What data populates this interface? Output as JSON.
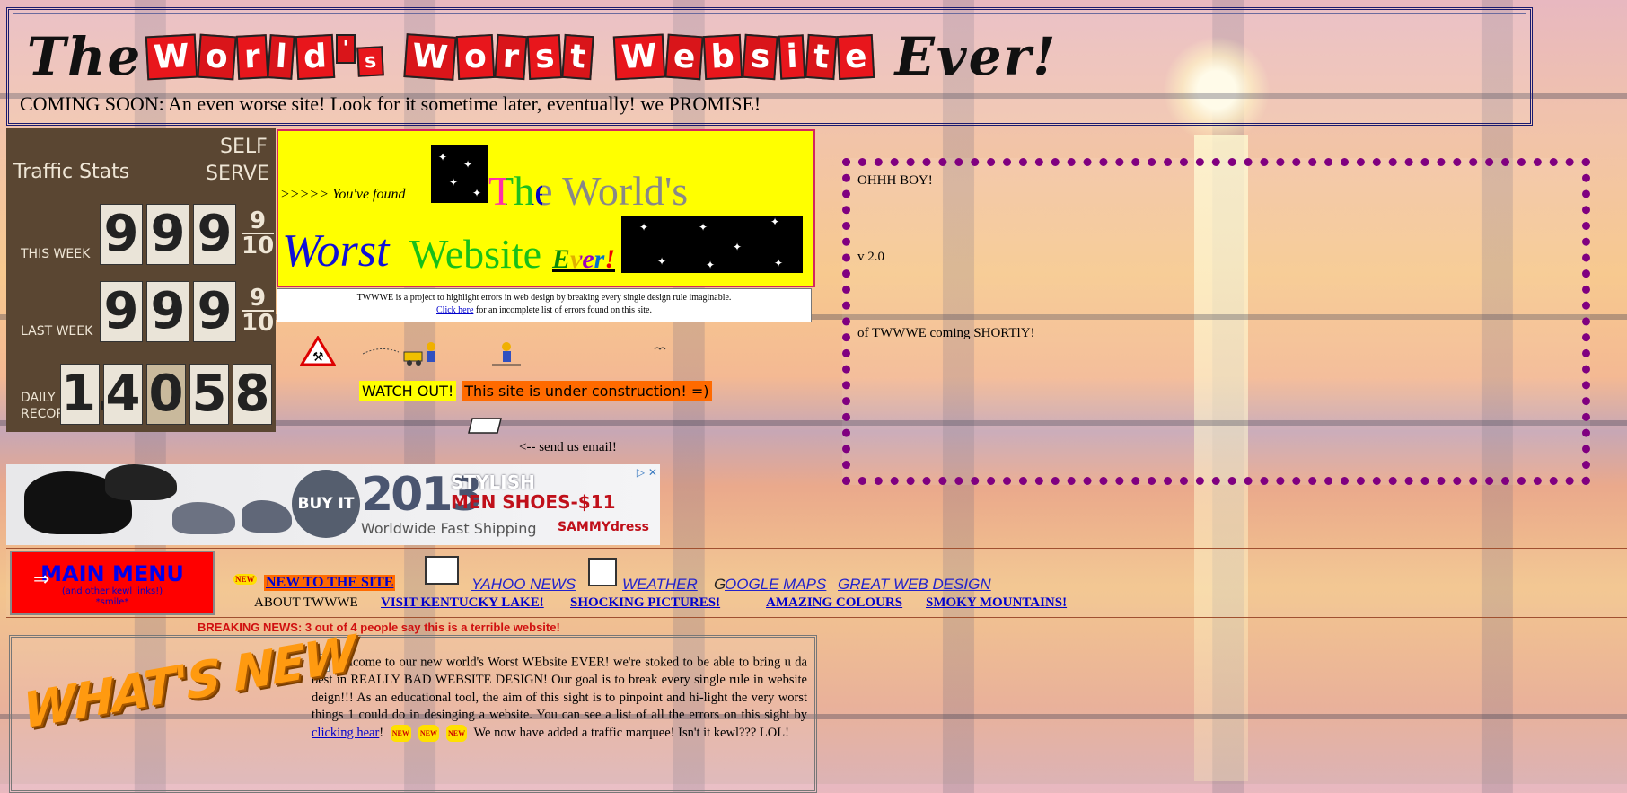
{
  "header": {
    "title_the": "The",
    "title_world_letters": [
      "W",
      "o",
      "r",
      "l",
      "d",
      "'",
      "s"
    ],
    "title_worst_letters": [
      "W",
      "o",
      "r",
      "s",
      "t"
    ],
    "title_website_letters": [
      "W",
      "e",
      "b",
      "s",
      "i",
      "t",
      "e"
    ],
    "title_ever": "Ever!",
    "coming_soon": "COMING SOON: An even worse site! Look for it sometime later, eventually!  we PROMISE!"
  },
  "traffic": {
    "title": "Traffic Stats",
    "self": "SELF",
    "serve": "SERVE",
    "this_week_label": "THIS WEEK",
    "this_week_digits": [
      "9",
      "9",
      "9"
    ],
    "this_week_frac_top": "9",
    "this_week_frac_bottom": "10",
    "last_week_label": "LAST WEEK",
    "last_week_digits": [
      "9",
      "9",
      "9"
    ],
    "last_week_frac_top": "9",
    "last_week_frac_bottom": "10",
    "daily_label": "DAILY",
    "record_label": "RECORD",
    "daily_digits": [
      "1.",
      "4",
      "0",
      "5",
      "8"
    ]
  },
  "banner": {
    "found": ">>>>> You've found",
    "the": "The World's",
    "worst": "Worst",
    "website": "Website",
    "ever": "Ever!"
  },
  "description": {
    "line1": "TWWWE is a project to highlight errors in web design by breaking every single design rule imaginable.",
    "click_here": "Click here",
    "line2_rest": " for an incomplete list of errors found on this site."
  },
  "construction": {
    "watch_out": "WATCH OUT!",
    "under_construction": "This site is under construction! =)",
    "send_email": "<-- send us email!"
  },
  "ad": {
    "buy_it": "BUY IT",
    "year": "2013",
    "stylish": "STYLISH",
    "men_shoes": "MEN SHOES-$11",
    "shipping": "Worldwide Fast Shipping",
    "brand": "SAMMYdress"
  },
  "dotted_box": {
    "line1": "OHHH BOY!",
    "line2": "v 2.0",
    "line3": "of TWWWE coming SHORTlY!"
  },
  "menu": {
    "main_menu": "MAIN MENU",
    "sub1": "(and other kewl links!)",
    "sub2": "*smile*",
    "new_badge": "NEW",
    "new_to_site": "NEW TO THE SITE",
    "yahoo_news": "YAHOO NEWS",
    "weather": "WEATHER",
    "google_maps_g": "G",
    "google_maps": "OOGLE MAPS",
    "great_web_design": "GREAT WEB DESIGN",
    "about": "ABOUT TWWWE",
    "kentucky": "VISIT KENTUCKY LAKE!",
    "shocking": "SHOCKING PICTURES!",
    "colours": "AMAZING COLOURS",
    "smoky": "SMOKY MOUNTAINS!"
  },
  "breaking_news": "BREAKING NEWS:  3 out of 4 people say this is a terrible website!",
  "whats_new": {
    "title": "WHAT'S NEW",
    "text1": "Welcome to our new world's Worst WEbsite EVER!  we're stoked to be able to bring u da best in REALLY BAD WEBSITE DESIGN!  Our goal is to break every single rule in website deign!!!      As an educational tool, the aim of this sight is to pinpoint and hi-light the very worst things 1 could do in desinging a website.  You can see a list of all the errors on this sight by ",
    "link": "clicking hear",
    "text2": "!",
    "new_badge": "NEW",
    "text3": " We now have added a traffic marquee!  Isn't it kewl??? LOL!"
  }
}
